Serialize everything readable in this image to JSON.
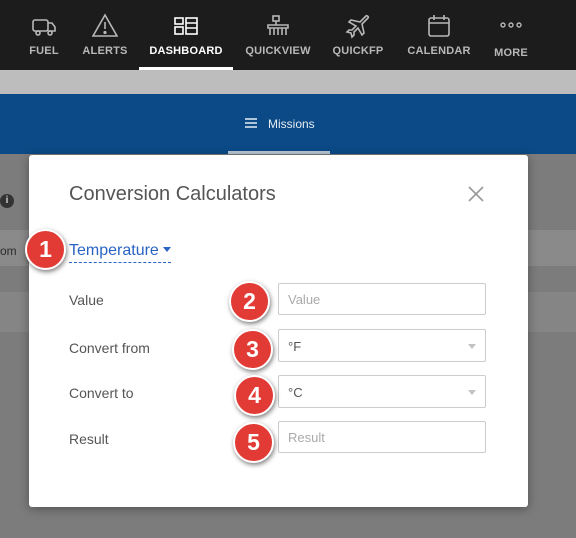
{
  "nav": {
    "items": [
      {
        "label": "FUEL",
        "icon": "fuel-truck-icon"
      },
      {
        "label": "ALERTS",
        "icon": "alert-triangle-icon"
      },
      {
        "label": "DASHBOARD",
        "icon": "dashboard-icon",
        "active": true
      },
      {
        "label": "QUICKVIEW",
        "icon": "quickview-icon"
      },
      {
        "label": "QUICKFP",
        "icon": "airplane-icon"
      },
      {
        "label": "CALENDAR",
        "icon": "calendar-icon"
      },
      {
        "label": "MORE",
        "icon": "more-dots-icon"
      }
    ]
  },
  "subnav": {
    "missions_label": "Missions",
    "icon": "hamburger-icon"
  },
  "background": {
    "from_text": "om"
  },
  "modal": {
    "title": "Conversion Calculators",
    "calculator_type": "Temperature",
    "fields": {
      "value": {
        "label": "Value",
        "placeholder": "Value"
      },
      "convert_from": {
        "label": "Convert from",
        "selected": "°F"
      },
      "convert_to": {
        "label": "Convert to",
        "selected": "°C"
      },
      "result": {
        "label": "Result",
        "placeholder": "Result"
      }
    }
  },
  "markers": [
    "1",
    "2",
    "3",
    "4",
    "5"
  ],
  "colors": {
    "nav_bg": "#1c1c1c",
    "bar_blue": "#0b4a86",
    "link_blue": "#2a64c3",
    "marker_red": "#e23b35"
  }
}
